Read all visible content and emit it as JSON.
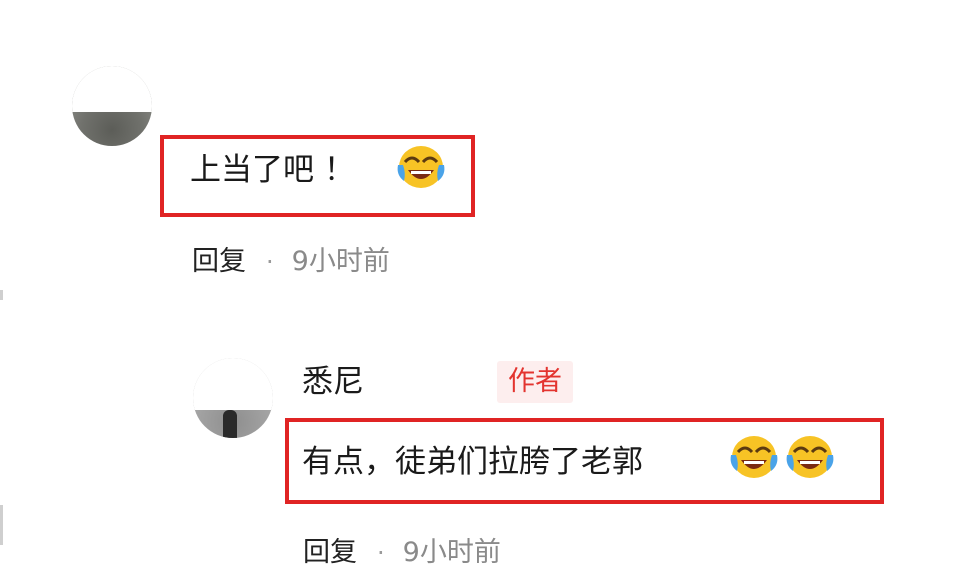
{
  "comments": [
    {
      "text": "上当了吧 ！",
      "emojis": [
        "crying-laughing-emoji"
      ],
      "reply_label": "回复",
      "separator": "·",
      "time": "9小时前"
    },
    {
      "author": "悉尼",
      "author_badge": "作者",
      "text": "有点，徒弟们拉胯了老郭",
      "emojis": [
        "crying-laughing-emoji",
        "crying-laughing-emoji"
      ],
      "reply_label": "回复",
      "separator": "·",
      "time": "9小时前"
    }
  ],
  "colors": {
    "highlight_border": "#e02424",
    "badge_text": "#e3342f",
    "badge_background": "#fdeeee",
    "meta_text": "#8a8a8a"
  }
}
